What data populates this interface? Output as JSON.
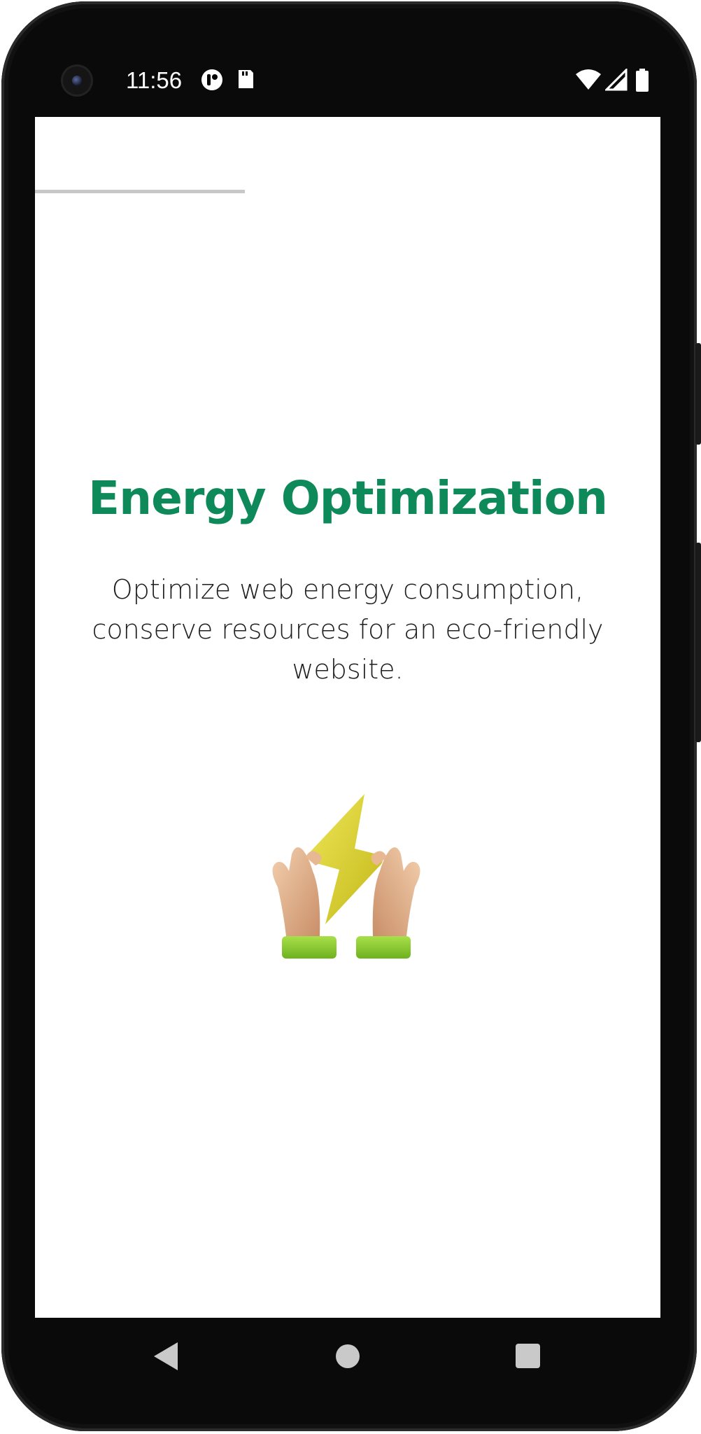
{
  "status_bar": {
    "time": "11:56",
    "icons": [
      "camera-icon",
      "notification-app-icon",
      "sd-card-icon",
      "wifi-icon",
      "cellular-signal-icon",
      "battery-icon"
    ]
  },
  "onboarding": {
    "progress_fraction": 0.33,
    "title": "Energy Optimization",
    "description": "Optimize web energy consumption, conserve resources for an eco-friendly website.",
    "illustration": "hands-holding-lightning-bolt-icon"
  },
  "navigation_bar": {
    "icons": [
      "back-icon",
      "home-icon",
      "recents-icon"
    ]
  },
  "colors": {
    "title": "#0e8a5a",
    "progress_track": "#c8c8c8",
    "bolt": "#d9d12a",
    "cuff": "#8fd12f",
    "skin": "#e7b58e"
  }
}
